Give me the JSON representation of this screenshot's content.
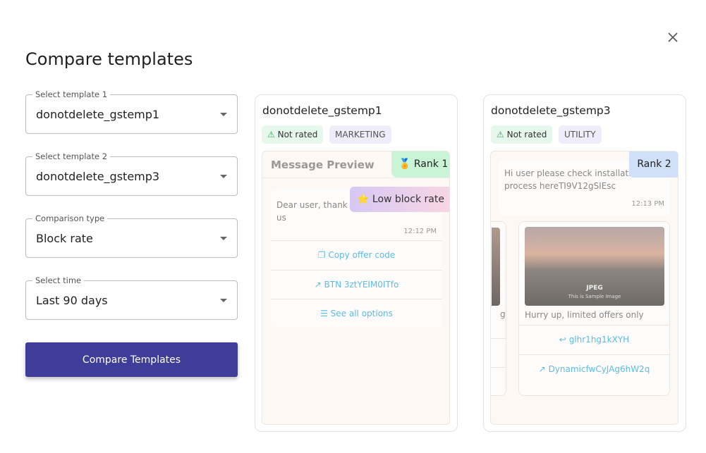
{
  "dialog": {
    "title": "Compare templates"
  },
  "form": {
    "template1": {
      "label": "Select template 1",
      "value": "donotdelete_gstemp1"
    },
    "template2": {
      "label": "Select template 2",
      "value": "donotdelete_gstemp3"
    },
    "comparison": {
      "label": "Comparison type",
      "value": "Block rate"
    },
    "time": {
      "label": "Select time",
      "value": "Last 90 days"
    },
    "submit": "Compare Templates"
  },
  "cards": [
    {
      "name": "donotdelete_gstemp1",
      "rating": "Not rated",
      "category": "MARKETING",
      "preview_title": "Message Preview",
      "rank": "Rank 1",
      "highlight": "Low block rate",
      "body": "Dear user, thank you for choosing us",
      "time": "12:12 PM",
      "buttons": [
        "Copy offer code",
        "BTN 3ztYEIM0ITfo",
        "See all options"
      ]
    },
    {
      "name": "donotdelete_gstemp3",
      "rating": "Not rated",
      "category": "UTILITY",
      "rank": "Rank 2",
      "body": "Hi user please check installation process hereTI9V12gSIEsc",
      "time": "12:13 PM",
      "carousel_prev_caption": "g",
      "image_label": "JPEG",
      "image_sub": "This is Sample Image",
      "caption": "Hurry up, limited offers only",
      "buttons": [
        "glhr1hg1kXYH",
        "DynamicfwCyJAg6hW2q"
      ]
    }
  ],
  "colors": {
    "primary": "#3e3d9a",
    "rank1": "#c9f5d6",
    "rank2": "#cfe0f8",
    "link": "#5bbce6"
  }
}
